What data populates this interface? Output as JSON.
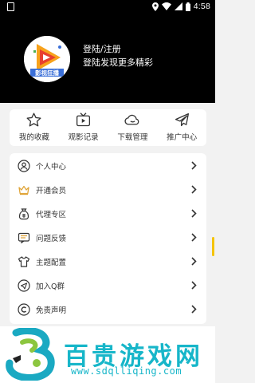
{
  "status_bar": {
    "time": "4:58"
  },
  "header": {
    "avatar_text": "影视狂播",
    "login_title": "登陆/注册",
    "login_subtitle": "登陆发现更多精彩"
  },
  "quick_actions": [
    {
      "label": "我的收藏",
      "icon": "star-icon"
    },
    {
      "label": "观影记录",
      "icon": "tv-icon"
    },
    {
      "label": "下载管理",
      "icon": "download-cloud-icon"
    },
    {
      "label": "推广中心",
      "icon": "paper-plane-icon"
    }
  ],
  "menu": [
    {
      "label": "个人中心",
      "icon": "user-icon"
    },
    {
      "label": "开通会员",
      "icon": "crown-icon"
    },
    {
      "label": "代理专区",
      "icon": "money-bag-icon"
    },
    {
      "label": "问题反馈",
      "icon": "feedback-icon"
    },
    {
      "label": "主题配置",
      "icon": "shirt-icon"
    },
    {
      "label": "加入Q群",
      "icon": "send-icon"
    },
    {
      "label": "免责声明",
      "icon": "copyright-icon"
    }
  ],
  "footer": {
    "watermark_title": "百贵游戏网",
    "watermark_url": "www.sdqlliqing.com"
  },
  "colors": {
    "accent": "#f5a623",
    "watermark": "#17b6c9",
    "header_bg": "#000000"
  }
}
